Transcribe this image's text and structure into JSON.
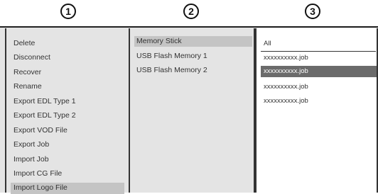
{
  "headers": [
    "1",
    "2",
    "3"
  ],
  "menu": {
    "items": [
      "Delete",
      "Disconnect",
      "Recover",
      "Rename",
      "Export EDL Type 1",
      "Export EDL Type 2",
      "Export VOD File",
      "Export Job",
      "Import Job",
      "Import CG File",
      "Import Logo File"
    ],
    "selected_index": 10
  },
  "devices": {
    "items": [
      "Memory Stick",
      "USB Flash Memory 1",
      "USB Flash Memory 2"
    ],
    "selected_index": 0
  },
  "files": {
    "all_label": "All",
    "items": [
      "xxxxxxxxxx.job",
      "xxxxxxxxxx.job",
      "xxxxxxxxxx.job",
      "xxxxxxxxxx.job"
    ],
    "selected_index": 1
  }
}
